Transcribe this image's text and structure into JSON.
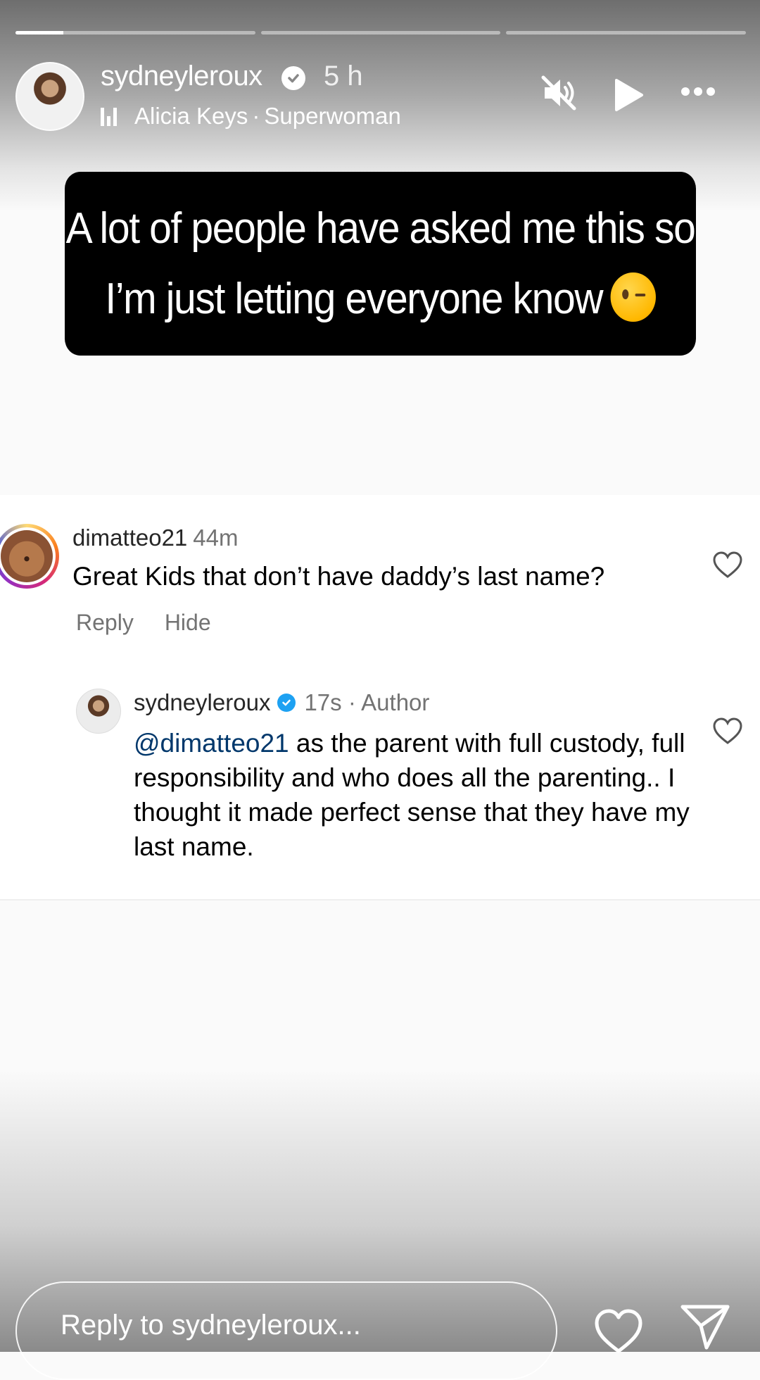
{
  "story": {
    "progress": [
      0.2,
      0,
      0
    ],
    "username": "sydneyleroux",
    "time": "5 h",
    "music_artist": "Alicia Keys",
    "music_separator": "·",
    "music_song": "Superwoman"
  },
  "caption": {
    "line1": "A lot of people have asked me this so",
    "line2": "I’m just letting everyone know"
  },
  "comment": {
    "username": "dimatteo21",
    "time": "44m",
    "text": "Great Kids that don’t have daddy’s last name?",
    "reply_label": "Reply",
    "hide_label": "Hide"
  },
  "reply": {
    "username": "sydneyleroux",
    "meta": "17s · Author",
    "mention": "@dimatteo21",
    "text": " as the parent with full custody, full responsibility and who does all the parenting.. I thought it made perfect sense that they have my last name."
  },
  "footer": {
    "reply_placeholder": "Reply to sydneyleroux..."
  }
}
